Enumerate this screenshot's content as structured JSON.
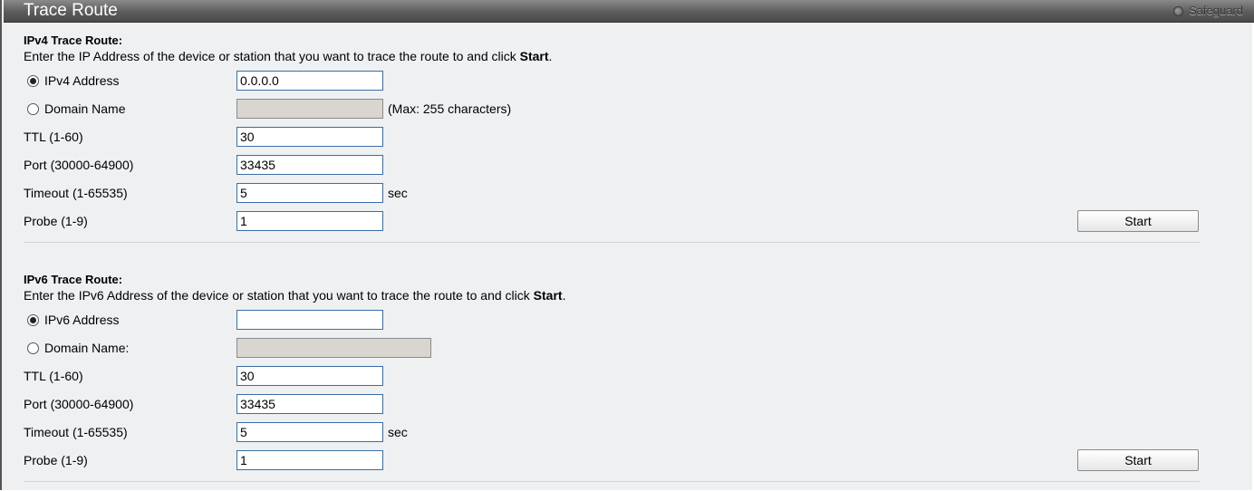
{
  "header": {
    "title": "Trace Route",
    "safeguard_label": "Safeguard"
  },
  "ipv4": {
    "section_title": "IPv4 Trace Route:",
    "description_prefix": "Enter the IP Address of the device or station that you want to trace the route to and click ",
    "description_bold": "Start",
    "description_suffix": ".",
    "address_radio_label": "IPv4 Address",
    "address_value": "0.0.0.0",
    "domain_radio_label": "Domain Name",
    "domain_value": "",
    "domain_hint": "(Max: 255 characters)",
    "ttl_label": "TTL (1-60)",
    "ttl_value": "30",
    "port_label": "Port (30000-64900)",
    "port_value": "33435",
    "timeout_label": "Timeout (1-65535)",
    "timeout_value": "5",
    "timeout_unit": "sec",
    "probe_label": "Probe (1-9)",
    "probe_value": "1",
    "start_button": "Start"
  },
  "ipv6": {
    "section_title": "IPv6 Trace Route:",
    "description_prefix": "Enter the IPv6 Address of the device or station that you want to trace the route to and click ",
    "description_bold": "Start",
    "description_suffix": ".",
    "address_radio_label": "IPv6 Address",
    "address_value": "",
    "domain_radio_label": "Domain Name:",
    "domain_value": "",
    "ttl_label": "TTL (1-60)",
    "ttl_value": "30",
    "port_label": "Port (30000-64900)",
    "port_value": "33435",
    "timeout_label": "Timeout (1-65535)",
    "timeout_value": "5",
    "timeout_unit": "sec",
    "probe_label": "Probe (1-9)",
    "probe_value": "1",
    "start_button": "Start"
  }
}
